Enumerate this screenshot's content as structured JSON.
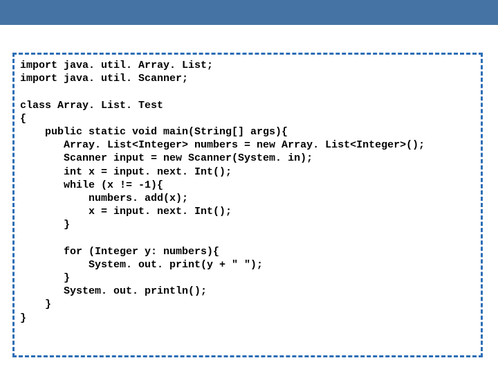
{
  "code": {
    "lines": [
      "import java. util. Array. List;",
      "import java. util. Scanner;",
      "",
      "class Array. List. Test",
      "{",
      "    public static void main(String[] args){",
      "       Array. List<Integer> numbers = new Array. List<Integer>();",
      "       Scanner input = new Scanner(System. in);",
      "       int x = input. next. Int();",
      "       while (x != -1){",
      "           numbers. add(x);",
      "           x = input. next. Int();",
      "       }",
      "",
      "       for (Integer y: numbers){",
      "           System. out. print(y + \" \");",
      "       }",
      "       System. out. println();",
      "    }",
      "}"
    ]
  }
}
